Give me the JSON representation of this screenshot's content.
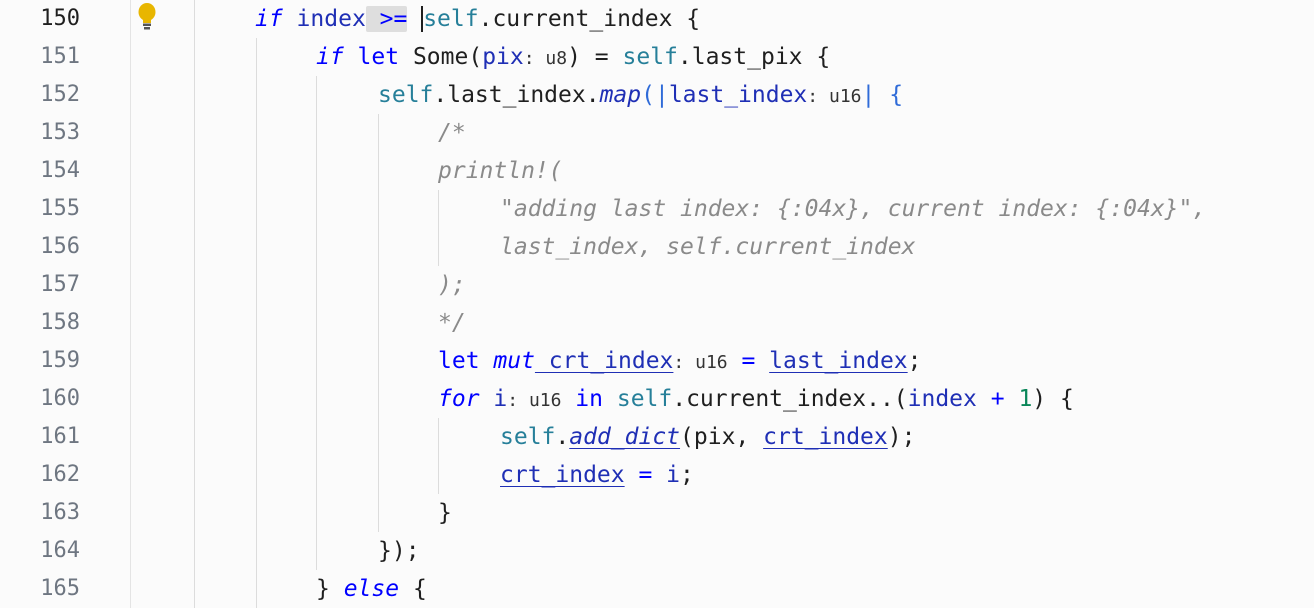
{
  "editor": {
    "active_line": 150,
    "line_numbers": [
      "150",
      "151",
      "152",
      "153",
      "154",
      "155",
      "156",
      "157",
      "158",
      "159",
      "160",
      "161",
      "162",
      "163",
      "164",
      "165"
    ],
    "gutter_icons": {
      "lightbulb_line": 150
    }
  },
  "code": {
    "l150": [
      "if",
      " index",
      " >=",
      "self",
      ".current_index {"
    ],
    "l151": [
      "if",
      " let",
      " Some(",
      "pix",
      ": ",
      "u8",
      ") = ",
      "self",
      ".last_pix {"
    ],
    "l152": [
      "self",
      ".last_index.",
      "map",
      "(|",
      "last_index",
      ": ",
      "u16",
      "| {"
    ],
    "l153": [
      "/*"
    ],
    "l154": [
      "println!("
    ],
    "l155": [
      "\"adding last index: {:04x}, current index: {:04x}\","
    ],
    "l156": [
      "last_index, self.current_index"
    ],
    "l157": [
      ");"
    ],
    "l158": [
      "*/"
    ],
    "l159": [
      "let",
      " mut",
      " crt_index",
      ": ",
      "u16",
      " = ",
      "last_index",
      ";"
    ],
    "l160": [
      "for",
      " i",
      ": ",
      "u16",
      " in ",
      "self",
      ".current_index..(",
      "index",
      " + ",
      "1",
      ") {"
    ],
    "l161": [
      "self",
      ".",
      "add_dict",
      "(pix, ",
      "crt_index",
      ");"
    ],
    "l162": [
      "crt_index",
      " = ",
      "i",
      ";"
    ],
    "l163": [
      "}"
    ],
    "l164": [
      "});"
    ],
    "l165": [
      "}",
      " else",
      " {"
    ]
  },
  "colors": {
    "background": "#fbfbfb",
    "keyword": "#0000ff",
    "variable": "#1f2fb5",
    "self": "#267f99",
    "number": "#098658",
    "comment": "#8a8a8a",
    "lightbulb": "#e8b600"
  }
}
